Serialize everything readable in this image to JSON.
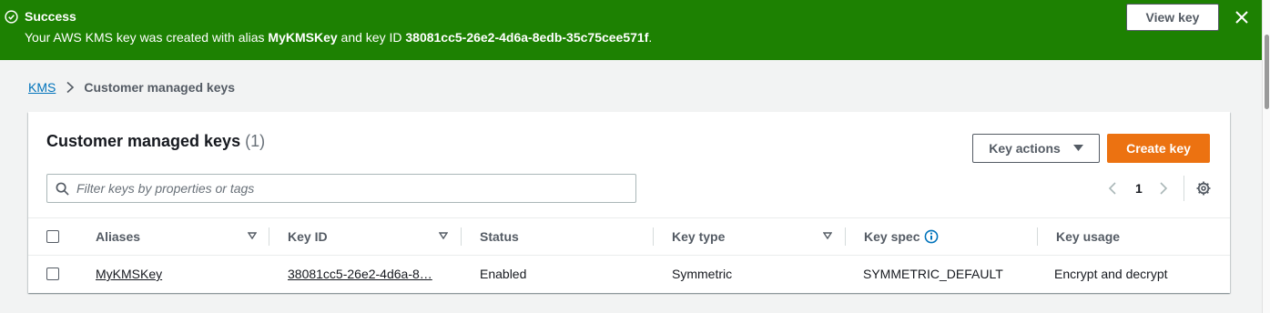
{
  "flash": {
    "title": "Success",
    "message_prefix": "Your AWS KMS key was created with alias ",
    "alias": "MyKMSKey",
    "message_middle": " and key ID ",
    "key_id": "38081cc5-26e2-4d6a-8edb-35c75cee571f",
    "message_suffix": ".",
    "view_key_label": "View key",
    "icon": "check-circle-icon",
    "close_icon": "close-icon"
  },
  "breadcrumb": {
    "root": "KMS",
    "current": "Customer managed keys"
  },
  "panel": {
    "title": "Customer managed keys",
    "count": "(1)",
    "key_actions_label": "Key actions",
    "create_key_label": "Create key",
    "filter_placeholder": "Filter keys by properties or tags",
    "page_number": "1"
  },
  "table": {
    "columns": [
      "Aliases",
      "Key ID",
      "Status",
      "Key type",
      "Key spec",
      "Key usage"
    ],
    "rows": [
      {
        "alias": "MyKMSKey",
        "key_id": "38081cc5-26e2-4d6a-8…",
        "status": "Enabled",
        "key_type": "Symmetric",
        "key_spec": "SYMMETRIC_DEFAULT",
        "key_usage": "Encrypt and decrypt"
      }
    ]
  },
  "colors": {
    "success_green": "#1d8102",
    "primary_orange": "#ec7211",
    "link_blue": "#0073bb"
  }
}
